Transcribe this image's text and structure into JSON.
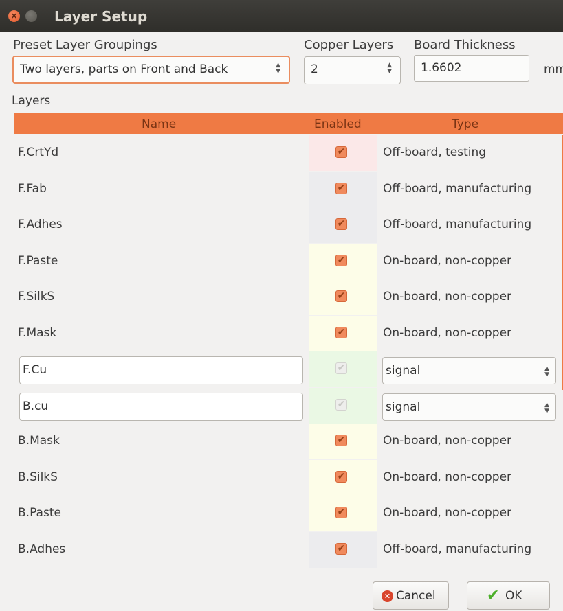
{
  "window": {
    "title": "Layer Setup",
    "close_glyph": "×",
    "min_glyph": "−"
  },
  "preset": {
    "label": "Preset Layer Groupings",
    "value": "Two layers, parts on Front and Back"
  },
  "copper": {
    "label": "Copper Layers",
    "value": "2"
  },
  "thickness": {
    "label": "Board Thickness",
    "value": "1.6602",
    "unit": "mm"
  },
  "layers": {
    "label": "Layers",
    "columns": {
      "name": "Name",
      "enabled": "Enabled",
      "type": "Type"
    },
    "rows": [
      {
        "name": "F.CrtYd",
        "type": "Off-board, testing",
        "bg": "#fbe8e8"
      },
      {
        "name": "F.Fab",
        "type": "Off-board, manufacturing",
        "bg": "#ececee"
      },
      {
        "name": "F.Adhes",
        "type": "Off-board, manufacturing",
        "bg": "#ececee"
      },
      {
        "name": "F.Paste",
        "type": "On-board, non-copper",
        "bg": "#fdfde8"
      },
      {
        "name": "F.SilkS",
        "type": "On-board, non-copper",
        "bg": "#fdfde8"
      },
      {
        "name": "F.Mask",
        "type": "On-board, non-copper",
        "bg": "#fdfde8"
      },
      {
        "name": "F.Cu",
        "type": "signal",
        "bg": "#eaf8e4",
        "editable": true
      },
      {
        "name": "B.cu",
        "type": "signal",
        "bg": "#eaf8e4",
        "editable": true
      },
      {
        "name": "B.Mask",
        "type": "On-board, non-copper",
        "bg": "#fdfde8"
      },
      {
        "name": "B.SilkS",
        "type": "On-board, non-copper",
        "bg": "#fdfde8"
      },
      {
        "name": "B.Paste",
        "type": "On-board, non-copper",
        "bg": "#fdfde8"
      },
      {
        "name": "B.Adhes",
        "type": "Off-board, manufacturing",
        "bg": "#ececee"
      }
    ]
  },
  "buttons": {
    "cancel": "Cancel",
    "ok": "OK"
  },
  "colors": {
    "accent": "#ef7a44",
    "titlebar": "#3c3b37"
  }
}
